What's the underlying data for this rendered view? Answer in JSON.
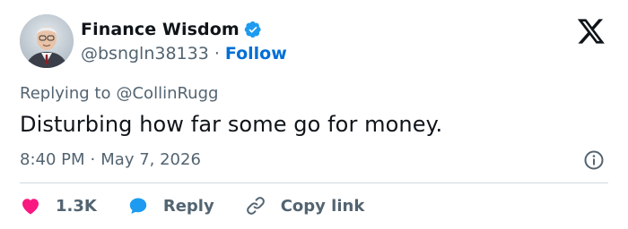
{
  "author": {
    "display_name": "Finance Wisdom",
    "handle": "@bsngln38133",
    "separator": "·",
    "follow_label": "Follow",
    "verified_icon": "verified-badge-icon"
  },
  "reply_context": {
    "prefix": "Replying to",
    "mention": "@CollinRugg"
  },
  "tweet": {
    "text": "Disturbing how far some go for money.",
    "time": "8:40 PM",
    "separator": "·",
    "date": "May 7, 2026"
  },
  "actions": {
    "like_count": "1.3K",
    "reply_label": "Reply",
    "copy_link_label": "Copy link"
  },
  "colors": {
    "accent_blue": "#006fd6",
    "verified_blue": "#1d9bf0",
    "like_pink": "#f91880",
    "secondary_text": "#536471",
    "primary_text": "#0f1419",
    "divider": "#cfd9de"
  },
  "icons": [
    "x-logo-icon",
    "verified-badge-icon",
    "info-icon",
    "heart-icon",
    "reply-bubble-icon",
    "link-icon"
  ]
}
